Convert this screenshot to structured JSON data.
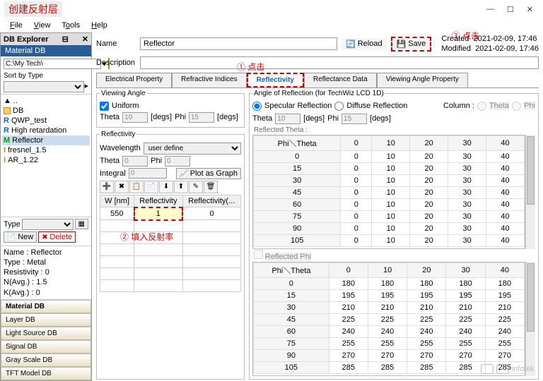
{
  "window_title": "创建反射层",
  "menu": [
    "File",
    "View",
    "Tools",
    "Help"
  ],
  "annotations": {
    "click1": "① 点击",
    "fill2": "② 填入反射率",
    "click3": "③ 点击"
  },
  "sidebar": {
    "header": "DB Explorer",
    "material_db": "Material DB",
    "path": "C:\\My Tech\\",
    "sort_label": "Sort by Type",
    "tree": [
      {
        "icon": "up",
        "label": ".."
      },
      {
        "icon": "folder",
        "label": "DB"
      },
      {
        "icon": "R",
        "label": "QWP_test"
      },
      {
        "icon": "R",
        "label": "High retardation"
      },
      {
        "icon": "M",
        "label": "Reflector",
        "selected": true
      },
      {
        "icon": "I",
        "label": "fresnel_1.5"
      },
      {
        "icon": "I",
        "label": "AR_1.22"
      }
    ],
    "type_label": "Type",
    "new_btn": "New",
    "delete_btn": "Delete",
    "info": {
      "name_label": "Name :",
      "name": "Reflector",
      "type_label": "Type :",
      "type": "Metal",
      "res_label": "Resistivity :",
      "res": "0",
      "navg_label": "N(Avg.) :",
      "navg": "1.5",
      "kavg_label": "K(Avg.) :",
      "kavg": "0"
    },
    "db_stack": [
      "Material DB",
      "Layer DB",
      "Light Source DB",
      "Signal DB",
      "Gray Scale DB",
      "TFT Model DB"
    ]
  },
  "content": {
    "name_label": "Name",
    "name_value": "Reflector",
    "desc_label": "Description",
    "desc_value": "",
    "reload": "Reload",
    "save": "Save",
    "created_label": "Created",
    "created_value": "2021-02-09, 17:46",
    "modified_label": "Modified",
    "modified_value": "2021-02-09, 17:46",
    "tabs": [
      "Electrical Property",
      "Refractive Indices",
      "Reflectivity",
      "Reflectance Data",
      "Viewing Angle Property"
    ],
    "viewing_angle": {
      "legend": "Viewing Angle",
      "uniform": "Uniform",
      "theta_label": "Theta",
      "theta_val": "10",
      "degs": "[degs]",
      "phi_label": "Phi",
      "phi_val": "15"
    },
    "reflectivity_box": {
      "legend": "Reflectivity",
      "wavelength_label": "Wavelength",
      "wavelength_val": "user define",
      "theta_label": "Theta",
      "theta_val": "0",
      "phi_label": "Phi",
      "phi_val": "0",
      "integral_label": "Integral",
      "integral_val": "0",
      "plot_btn": "Plot as Graph",
      "cols": [
        "W [nm]",
        "Reflectivity",
        "Reflectivity(..."
      ],
      "row": [
        "550",
        "1",
        "0"
      ]
    },
    "angle_reflection": {
      "legend": "Angle of Reflection  (for TechWiz LCD 1D)",
      "specular": "Specular Reflection",
      "diffuse": "Diffuse Reflection",
      "column_label": "Column :",
      "theta_opt": "Theta",
      "phi_opt": "Phi",
      "theta_label": "Theta",
      "theta_val": "10",
      "phi_label": "Phi",
      "phi_val": "15",
      "degs": "[degs]",
      "reflected_theta_label": "Reflected Theta :",
      "reflected_phi_label": "Reflected Phi",
      "pt_header": "Phi＼Theta",
      "cols": [
        "0",
        "10",
        "20",
        "30",
        "40"
      ],
      "theta_rows": [
        {
          "r": "0",
          "v": [
            "0",
            "10",
            "20",
            "30",
            "40"
          ]
        },
        {
          "r": "15",
          "v": [
            "0",
            "10",
            "20",
            "30",
            "40"
          ]
        },
        {
          "r": "30",
          "v": [
            "0",
            "10",
            "20",
            "30",
            "40"
          ]
        },
        {
          "r": "45",
          "v": [
            "0",
            "10",
            "20",
            "30",
            "40"
          ]
        },
        {
          "r": "60",
          "v": [
            "0",
            "10",
            "20",
            "30",
            "40"
          ]
        },
        {
          "r": "75",
          "v": [
            "0",
            "10",
            "20",
            "30",
            "40"
          ]
        },
        {
          "r": "90",
          "v": [
            "0",
            "10",
            "20",
            "30",
            "40"
          ]
        },
        {
          "r": "105",
          "v": [
            "0",
            "10",
            "20",
            "30",
            "40"
          ]
        }
      ],
      "phi_rows": [
        {
          "r": "0",
          "v": [
            "180",
            "180",
            "180",
            "180",
            "180"
          ]
        },
        {
          "r": "15",
          "v": [
            "195",
            "195",
            "195",
            "195",
            "195"
          ]
        },
        {
          "r": "30",
          "v": [
            "210",
            "210",
            "210",
            "210",
            "210"
          ]
        },
        {
          "r": "45",
          "v": [
            "225",
            "225",
            "225",
            "225",
            "225"
          ]
        },
        {
          "r": "60",
          "v": [
            "240",
            "240",
            "240",
            "240",
            "240"
          ]
        },
        {
          "r": "75",
          "v": [
            "255",
            "255",
            "255",
            "255",
            "255"
          ]
        },
        {
          "r": "90",
          "v": [
            "270",
            "270",
            "270",
            "270",
            "270"
          ]
        },
        {
          "r": "105",
          "v": [
            "285",
            "285",
            "285",
            "285",
            "285"
          ]
        }
      ]
    }
  },
  "watermark": "infotek"
}
